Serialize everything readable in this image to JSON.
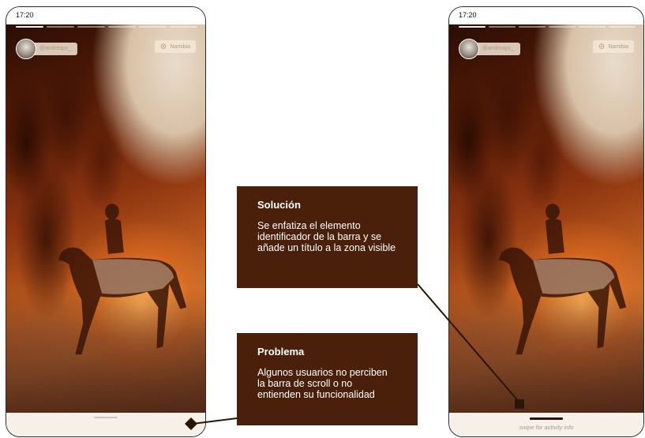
{
  "phones": {
    "left": {
      "status_time": "17:20",
      "username": "@andreapc_",
      "location": "Namibia",
      "sheet_title": ""
    },
    "right": {
      "status_time": "17:20",
      "username": "@andreapc_",
      "location": "Namibia",
      "sheet_title": "swipe for activity info"
    }
  },
  "callouts": {
    "solution": {
      "title": "Solución",
      "body": "Se enfatiza el elemento identificador de la barra y se añade un título a la zona visible"
    },
    "problem": {
      "title": "Problema",
      "body": "Algunos usuarios no perciben la barra de scroll o no entienden su funcionalidad"
    }
  },
  "icons": {
    "location": "map-pin-icon",
    "avatar": "user-avatar"
  },
  "colors": {
    "callout_bg": "#4a200a",
    "sheet_bg": "#f6f0e9",
    "chip_text": "#b39a7e"
  }
}
